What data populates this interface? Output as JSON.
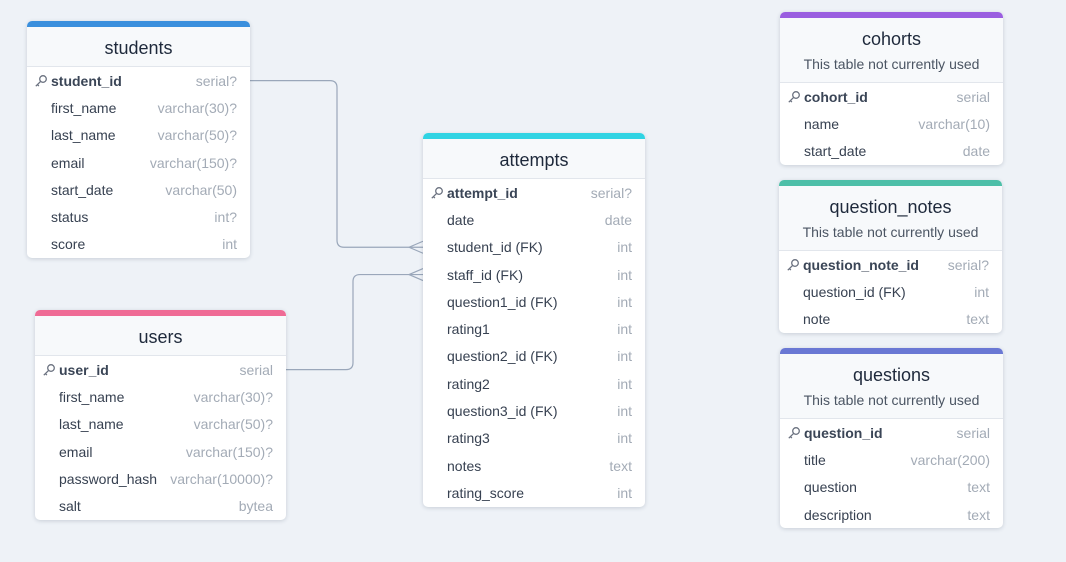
{
  "colors": {
    "background": "#eef2f7",
    "connector": "#9aa7ba",
    "students_accent": "#3a8fdd",
    "users_accent": "#ef6b95",
    "attempts_accent": "#2fd3e3",
    "cohorts_accent": "#9a5ee0",
    "question_notes_accent": "#4dbfa8",
    "questions_accent": "#6a78d4"
  },
  "tables": [
    {
      "id": "students",
      "name": "students",
      "note": "",
      "accent": "#3a8fdd",
      "columns": [
        {
          "name": "student_id",
          "type": "serial?",
          "pk": true
        },
        {
          "name": "first_name",
          "type": "varchar(30)?"
        },
        {
          "name": "last_name",
          "type": "varchar(50)?"
        },
        {
          "name": "email",
          "type": "varchar(150)?"
        },
        {
          "name": "start_date",
          "type": "varchar(50)"
        },
        {
          "name": "status",
          "type": "int?"
        },
        {
          "name": "score",
          "type": "int"
        }
      ]
    },
    {
      "id": "users",
      "name": "users",
      "note": "",
      "accent": "#ef6b95",
      "columns": [
        {
          "name": "user_id",
          "type": "serial",
          "pk": true
        },
        {
          "name": "first_name",
          "type": "varchar(30)?"
        },
        {
          "name": "last_name",
          "type": "varchar(50)?"
        },
        {
          "name": "email",
          "type": "varchar(150)?"
        },
        {
          "name": "password_hash",
          "type": "varchar(10000)?"
        },
        {
          "name": "salt",
          "type": "bytea"
        }
      ]
    },
    {
      "id": "attempts",
      "name": "attempts",
      "note": "",
      "accent": "#2fd3e3",
      "columns": [
        {
          "name": "attempt_id",
          "type": "serial?",
          "pk": true
        },
        {
          "name": "date",
          "type": "date"
        },
        {
          "name": "student_id (FK)",
          "type": "int"
        },
        {
          "name": "staff_id (FK)",
          "type": "int"
        },
        {
          "name": "question1_id (FK)",
          "type": "int"
        },
        {
          "name": "rating1",
          "type": "int"
        },
        {
          "name": "question2_id (FK)",
          "type": "int"
        },
        {
          "name": "rating2",
          "type": "int"
        },
        {
          "name": "question3_id (FK)",
          "type": "int"
        },
        {
          "name": "rating3",
          "type": "int"
        },
        {
          "name": "notes",
          "type": "text"
        },
        {
          "name": "rating_score",
          "type": "int"
        }
      ]
    },
    {
      "id": "cohorts",
      "name": "cohorts",
      "note": "This table not currently used",
      "accent": "#9a5ee0",
      "columns": [
        {
          "name": "cohort_id",
          "type": "serial",
          "pk": true
        },
        {
          "name": "name",
          "type": "varchar(10)"
        },
        {
          "name": "start_date",
          "type": "date"
        }
      ]
    },
    {
      "id": "question_notes",
      "name": "question_notes",
      "note": "This table not currently used",
      "accent": "#4dbfa8",
      "columns": [
        {
          "name": "question_note_id",
          "type": "serial?",
          "pk": true
        },
        {
          "name": "question_id (FK)",
          "type": "int"
        },
        {
          "name": "note",
          "type": "text"
        }
      ]
    },
    {
      "id": "questions",
      "name": "questions",
      "note": "This table not currently used",
      "accent": "#6a78d4",
      "columns": [
        {
          "name": "question_id",
          "type": "serial",
          "pk": true
        },
        {
          "name": "title",
          "type": "varchar(200)"
        },
        {
          "name": "question",
          "type": "text"
        },
        {
          "name": "description",
          "type": "text"
        }
      ]
    }
  ],
  "relationships": [
    {
      "from_table": "students",
      "from_column": "student_id",
      "to_table": "attempts",
      "to_column": "student_id (FK)",
      "cardinality": "one-to-many"
    },
    {
      "from_table": "users",
      "from_column": "user_id",
      "to_table": "attempts",
      "to_column": "staff_id (FK)",
      "cardinality": "one-to-many"
    }
  ]
}
